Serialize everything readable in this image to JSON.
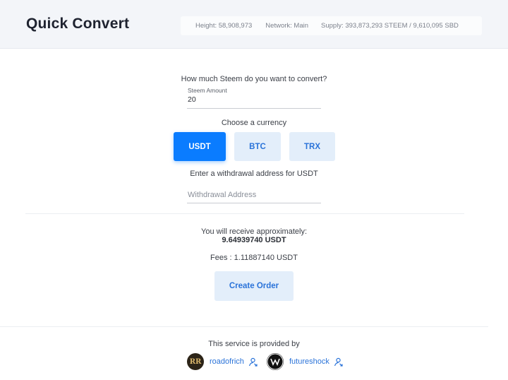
{
  "header": {
    "title": "Quick Convert",
    "stats": {
      "height": "Height: 58,908,973",
      "network": "Network: Main",
      "supply": "Supply: 393,873,293 STEEM / 9,610,095 SBD"
    }
  },
  "form": {
    "question": "How much Steem do you want to convert?",
    "amount_label": "Steem Amount",
    "amount_value": "20",
    "choose_currency": "Choose a currency",
    "currencies": [
      "USDT",
      "BTC",
      "TRX"
    ],
    "selected_currency": "USDT",
    "withdraw_label": "Enter a withdrawal address for USDT",
    "address_placeholder": "Withdrawal Address"
  },
  "result": {
    "receive_label": "You will receive approximately:",
    "receive_value": "9.64939740 USDT",
    "fees": "Fees : 1.11887140 USDT",
    "create_button": "Create Order"
  },
  "footer": {
    "provided_by": "This service is provided by",
    "providers": [
      {
        "name": "roadofrich",
        "avatar_text": "RR",
        "icon": "external-link-icon"
      },
      {
        "name": "futureshock",
        "avatar_text": "",
        "icon": "external-link-icon"
      }
    ]
  },
  "colors": {
    "primary": "#0a7cff",
    "secondary_bg": "#e3eefa",
    "link": "#2a73d9",
    "header_bg": "#f3f5f9"
  }
}
